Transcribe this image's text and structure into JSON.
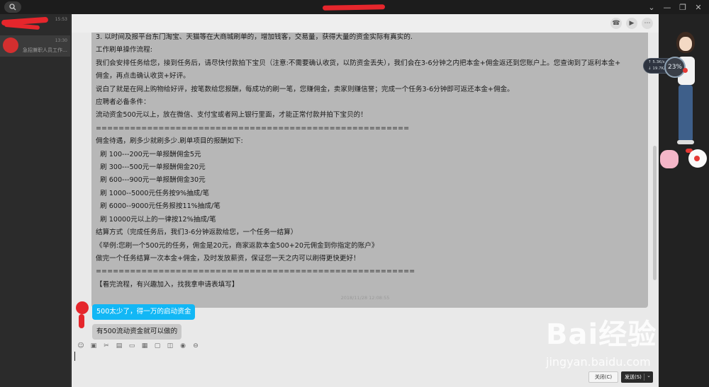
{
  "titlebar": {
    "title": ""
  },
  "sidebar": {
    "conversations": [
      {
        "time": "15:53",
        "preview": ""
      },
      {
        "time": "13:30",
        "preview": "急招兼职人员工作…"
      }
    ]
  },
  "chat": {
    "message_lines": [
      "3. 以时间及报平台东门淘宝、天猫等在大商城刷单的，增加钱客，交易量，获得大量的资金实际有真实的.",
      "工作刷单操作流程:",
      "我们会安排任务给您，接到任务后，请尽快付款拍下宝贝（注意:不需要确认收货，以防资金丢失），我们会在3-6分钟之内把本金+佣金返还到您账户上。您查询到了返利本金+",
      "佣金，再点击确认收货+好评。",
      "说白了就是在网上购物给好评，按笔数给您报酬，每成功的刷一笔，您赚佣金，卖家则赚信誉；完成一个任务3-6分钟即可返还本金+佣金。",
      "应聘者必备条件：",
      "流动资金500元以上，放在微信、支付宝或者网上银行里面，才能正常付款并拍下宝贝的！",
      "=======================================================",
      "佣金待遇，刷多少就刷多少.刷单项目的报酬如下:",
      "",
      "  刷 100---200元一单报酬佣金5元",
      "  刷 300---500元一单报酬佣金20元",
      "  刷 600---900元一单报酬佣金30元",
      "  刷 1000--5000元任务按9%抽成/笔",
      "  刷 6000--9000元任务报按11%抽成/笔",
      "  刷 10000元以上的一律按12%抽成/笔",
      "",
      "结算方式（完成任务后，我们3-6分钟返款给您，一个任务一结算）",
      "《举例:您刷一个500元的任务，佣金是20元，商家返款本金500+20元佣金到你指定的账户》",
      "做完一个任务结算一次本金+佣金，及时发放薪资，保证您一天之内可以刷得更快更好！",
      "========================================================",
      "【看完流程，有兴趣加入，找我拿申请表填写】"
    ],
    "timestamp": "2018/11/28 12:08:55",
    "my_message": "500太少了，得一万的启动资金",
    "their_message": "有500流动资金就可以做的",
    "close_button": "关闭(C)",
    "send_button": "发送(S)",
    "input_value": ""
  },
  "widget": {
    "upload_speed": "5.3K/s",
    "download_speed": "19.7K/s",
    "percent": "23%"
  },
  "watermark": {
    "brand": "Bai经验",
    "url": "jingyan.baidu.com"
  }
}
